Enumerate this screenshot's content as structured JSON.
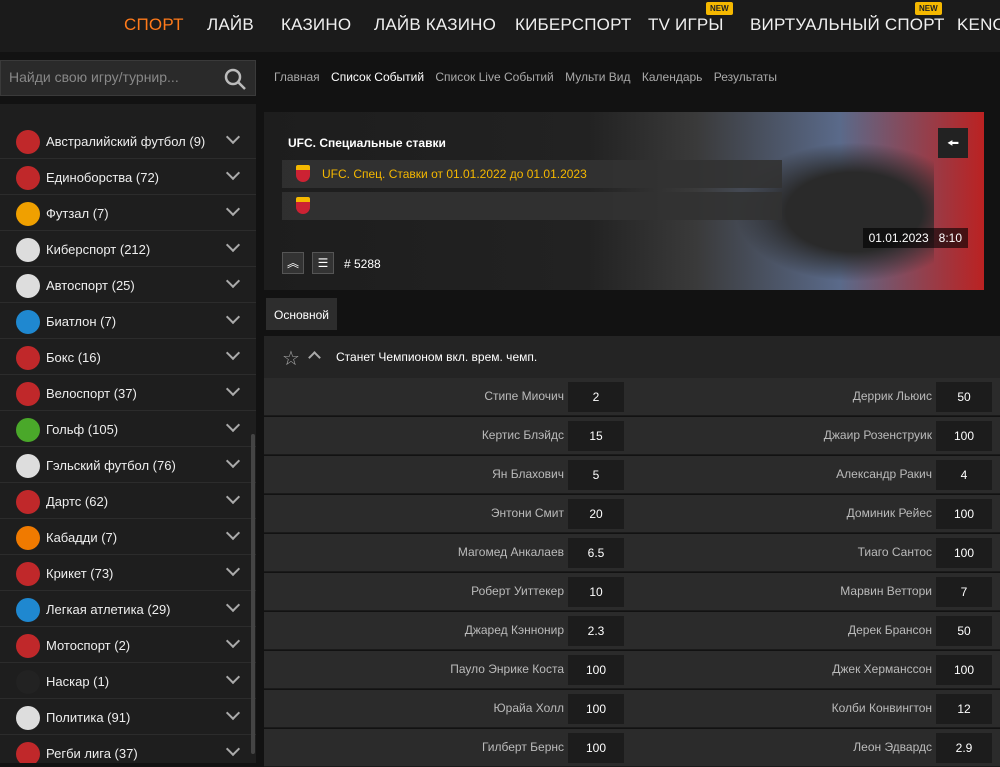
{
  "topnav": {
    "items": [
      "СПОРТ",
      "ЛАЙВ",
      "КАЗИНО",
      "ЛАЙВ КАЗИНО",
      "КИБЕРСПОРТ",
      "TV ИГРЫ",
      "ВИРТУАЛЬНЫЙ СПОРТ",
      "KENO"
    ],
    "badge": "NEW"
  },
  "search": {
    "placeholder": "Найди свою игру/турнир..."
  },
  "sidebar": {
    "items": [
      {
        "label": "Австралийский футбол (9)",
        "icon": "australian-football-icon",
        "color": "#c0282a"
      },
      {
        "label": "Единоборства (72)",
        "icon": "martial-arts-icon",
        "color": "#c0282a"
      },
      {
        "label": "Футзал (7)",
        "icon": "futsal-icon",
        "color": "#f0a000"
      },
      {
        "label": "Киберспорт (212)",
        "icon": "gamepad-icon",
        "color": "#dddddd"
      },
      {
        "label": "Автоспорт (25)",
        "icon": "car-icon",
        "color": "#dddddd"
      },
      {
        "label": "Биатлон (7)",
        "icon": "biathlon-icon",
        "color": "#1f88d0"
      },
      {
        "label": "Бокс (16)",
        "icon": "boxing-glove-icon",
        "color": "#c0282a"
      },
      {
        "label": "Велоспорт (37)",
        "icon": "cycling-icon",
        "color": "#c0282a"
      },
      {
        "label": "Гольф (105)",
        "icon": "golf-icon",
        "color": "#4aa82a"
      },
      {
        "label": "Гэльский футбол (76)",
        "icon": "gaelic-football-icon",
        "color": "#dddddd"
      },
      {
        "label": "Дартс (62)",
        "icon": "darts-icon",
        "color": "#c0282a"
      },
      {
        "label": "Кабадди (7)",
        "icon": "kabaddi-icon",
        "color": "#f07a00"
      },
      {
        "label": "Крикет (73)",
        "icon": "cricket-icon",
        "color": "#c0282a"
      },
      {
        "label": "Легкая атлетика (29)",
        "icon": "athletics-icon",
        "color": "#1f88d0"
      },
      {
        "label": "Мотоспорт (2)",
        "icon": "motorbike-icon",
        "color": "#c0282a"
      },
      {
        "label": "Наскар (1)",
        "icon": "nascar-icon",
        "color": "#222222"
      },
      {
        "label": "Политика (91)",
        "icon": "megaphone-icon",
        "color": "#dddddd"
      },
      {
        "label": "Регби лига (37)",
        "icon": "rugby-icon",
        "color": "#c0282a"
      }
    ]
  },
  "breadcrumbs": [
    "Главная",
    "Список Событий",
    "Список Live Событий",
    "Мульти Вид",
    "Календарь",
    "Результаты"
  ],
  "hero": {
    "title": "UFC. Специальные ставки",
    "row_label": "UFC. Спец. Ставки от 01.01.2022 до 01.01.2023",
    "event_id": "# 5288",
    "date": "01.01.2023",
    "time": "8:10",
    "back_glyph": "🠘"
  },
  "tabs": {
    "main": "Основной"
  },
  "market": {
    "name": "Станет Чемпионом вкл. врем. чемп."
  },
  "odds": [
    {
      "left_name": "Стипе Миочич",
      "left_odd": "2",
      "right_name": "Деррик Льюис",
      "right_odd": "50"
    },
    {
      "left_name": "Кертис Блэйдс",
      "left_odd": "15",
      "right_name": "Джаир Розенструик",
      "right_odd": "100"
    },
    {
      "left_name": "Ян Блахович",
      "left_odd": "5",
      "right_name": "Александр Ракич",
      "right_odd": "4"
    },
    {
      "left_name": "Энтони Смит",
      "left_odd": "20",
      "right_name": "Доминик Рейес",
      "right_odd": "100"
    },
    {
      "left_name": "Магомед Анкалаев",
      "left_odd": "6.5",
      "right_name": "Тиаго Сантос",
      "right_odd": "100"
    },
    {
      "left_name": "Роберт Уиттекер",
      "left_odd": "10",
      "right_name": "Марвин Веттори",
      "right_odd": "7"
    },
    {
      "left_name": "Джаред Кэннонир",
      "left_odd": "2.3",
      "right_name": "Дерек Брансон",
      "right_odd": "50"
    },
    {
      "left_name": "Пауло Энрике Коста",
      "left_odd": "100",
      "right_name": "Джек Херманссон",
      "right_odd": "100"
    },
    {
      "left_name": "Юрайа Холл",
      "left_odd": "100",
      "right_name": "Колби Конвингтон",
      "right_odd": "12"
    },
    {
      "left_name": "Гилберт Бернс",
      "left_odd": "100",
      "right_name": "Леон Эдвардс",
      "right_odd": "2.9"
    }
  ]
}
